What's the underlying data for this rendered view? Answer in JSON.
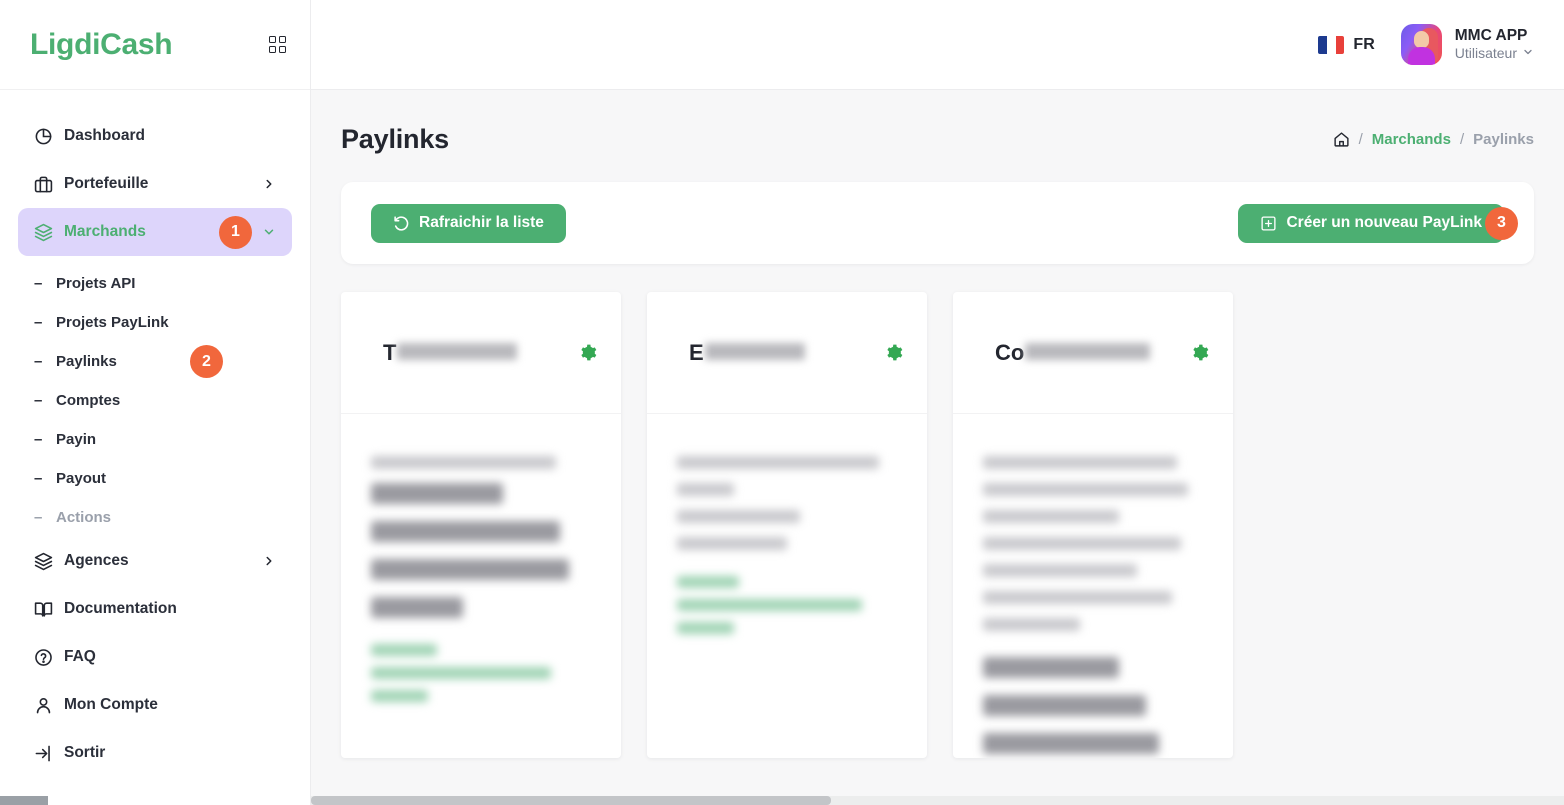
{
  "brand": {
    "name": "LigdiCash",
    "grid_icon": "grid-icon"
  },
  "sidebar": {
    "items": [
      {
        "label": "Dashboard",
        "icon": "pie-chart-icon",
        "type": "link"
      },
      {
        "label": "Portefeuille",
        "icon": "briefcase-icon",
        "type": "expandable",
        "chevron": "chevron-right-icon"
      },
      {
        "label": "Marchands",
        "icon": "layers-icon",
        "type": "expandable",
        "active": true,
        "badge": "1",
        "chevron": "chevron-down-icon"
      }
    ],
    "sub_items": [
      {
        "label": "Projets API",
        "dash": "–"
      },
      {
        "label": "Projets PayLink",
        "dash": "–"
      },
      {
        "label": "Paylinks",
        "dash": "–",
        "badge": "2"
      },
      {
        "label": "Comptes",
        "dash": "–"
      },
      {
        "label": "Payin",
        "dash": "–"
      },
      {
        "label": "Payout",
        "dash": "–"
      },
      {
        "label": "Actions",
        "dash": "–",
        "muted": true
      }
    ],
    "items_lower": [
      {
        "label": "Agences",
        "icon": "layers-icon",
        "type": "expandable",
        "chevron": "chevron-right-icon"
      },
      {
        "label": "Documentation",
        "icon": "book-icon",
        "type": "link"
      },
      {
        "label": "FAQ",
        "icon": "question-circle-icon",
        "type": "link"
      },
      {
        "label": "Mon Compte",
        "icon": "user-icon",
        "type": "link"
      },
      {
        "label": "Sortir",
        "icon": "logout-icon",
        "type": "link"
      }
    ]
  },
  "topbar": {
    "language": {
      "code": "FR",
      "flag": "french-flag-icon"
    },
    "user": {
      "name": "MMC APP",
      "role": "Utilisateur",
      "chevron": "chevron-down-icon",
      "avatar": "user-avatar"
    }
  },
  "page": {
    "title": "Paylinks",
    "breadcrumb": {
      "home_icon": "home-icon",
      "separator": "/",
      "parent": "Marchands",
      "current": "Paylinks"
    }
  },
  "toolbar": {
    "refresh_label": "Rafraichir la liste",
    "refresh_icon": "refresh-icon",
    "create_label": "Créer un nouveau PayLink",
    "create_icon": "plus-square-icon",
    "create_badge": "3"
  },
  "cards": [
    {
      "title_visible": "T",
      "title_redacted_width": 120,
      "gear_icon": "gear-icon"
    },
    {
      "title_visible": "E",
      "title_redacted_width": 100,
      "gear_icon": "gear-icon"
    },
    {
      "title_visible": "Co",
      "title_redacted_width": 125,
      "gear_icon": "gear-icon"
    }
  ],
  "colors": {
    "brand_green": "#4caf72",
    "badge_orange": "#f1673c",
    "active_nav_bg": "#ddd5fb",
    "page_bg": "#f7f7f8",
    "text_dark": "#23262f",
    "text_muted": "#9aa0ab"
  },
  "scrollbar": {
    "orientation": "horizontal"
  }
}
